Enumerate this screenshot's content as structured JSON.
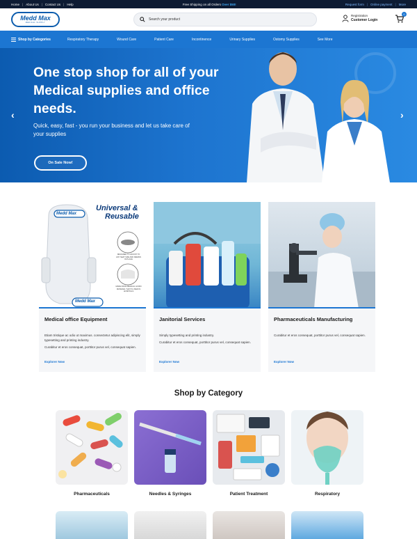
{
  "topbar": {
    "links": [
      "Home",
      "About Us",
      "Contact Us",
      "Help"
    ],
    "shipping_text": "Free Shipping on all Orders",
    "shipping_amount": "Over $50!",
    "right_links": [
      "Request form",
      "Online payment",
      "More"
    ]
  },
  "header": {
    "logo_main": "Medd Max",
    "logo_sub": "MEDICAL SUPPLY",
    "search_placeholder": "Search your product",
    "account_line1": "Registration",
    "account_line2": "Customer Login",
    "cart_count": "0"
  },
  "nav": {
    "categories_label": "Shop by Categories",
    "items": [
      "Respiratory Therapy",
      "Wound Care",
      "Patient Care",
      "Incontinence",
      "Urinary Supplies",
      "Ostomy Supplies",
      "See More"
    ]
  },
  "hero": {
    "headline": "One stop shop for all of your Medical supplies and office needs.",
    "subtext": "Quick, easy, fast - you run your business and let us take care of your supplies",
    "button": "On Sale Now!"
  },
  "cards": [
    {
      "title": "Medical office Equipment",
      "desc1": "Etiam tristique ac odio ut maximus. consectetur adipiscing elit, simply typesetting and printing industry.",
      "desc2": "Curabitur et eros consequat, porttitor purus vel, consequat sapien.",
      "link": "Explorer Now",
      "badge1": "Universal &",
      "badge2": "Reusable",
      "logo": "Medd Max",
      "note1": "DESIGNED TO ADJUST TO ANY SEAT SIZE AND REMAIN IN PLACE",
      "note2": "MADE FROM MEDICAL GOWN MATERIAL THAT IS USED IN HOSPITALS"
    },
    {
      "title": "Janitorial Services",
      "desc1": "Simply typesetting and printing industry.",
      "desc2": "Curabitur et eros consequat, porttitor purus vel, consequat sapien.",
      "link": "Explorer Now"
    },
    {
      "title": "Pharmaceuticals Manufacturing",
      "desc1": "Curabitur et eros consequat, porttitor purus vel, consequat sapien.",
      "desc2": "",
      "link": "Explorer Now"
    }
  ],
  "shop": {
    "title": "Shop by Category",
    "categories": [
      "Pharmaceuticals",
      "Needles & Syringes",
      "Patient Treatment",
      "Respiratory"
    ]
  },
  "colors": {
    "primary": "#1c76d2",
    "dark": "#0d1b33",
    "accent": "#3fa9f5"
  }
}
